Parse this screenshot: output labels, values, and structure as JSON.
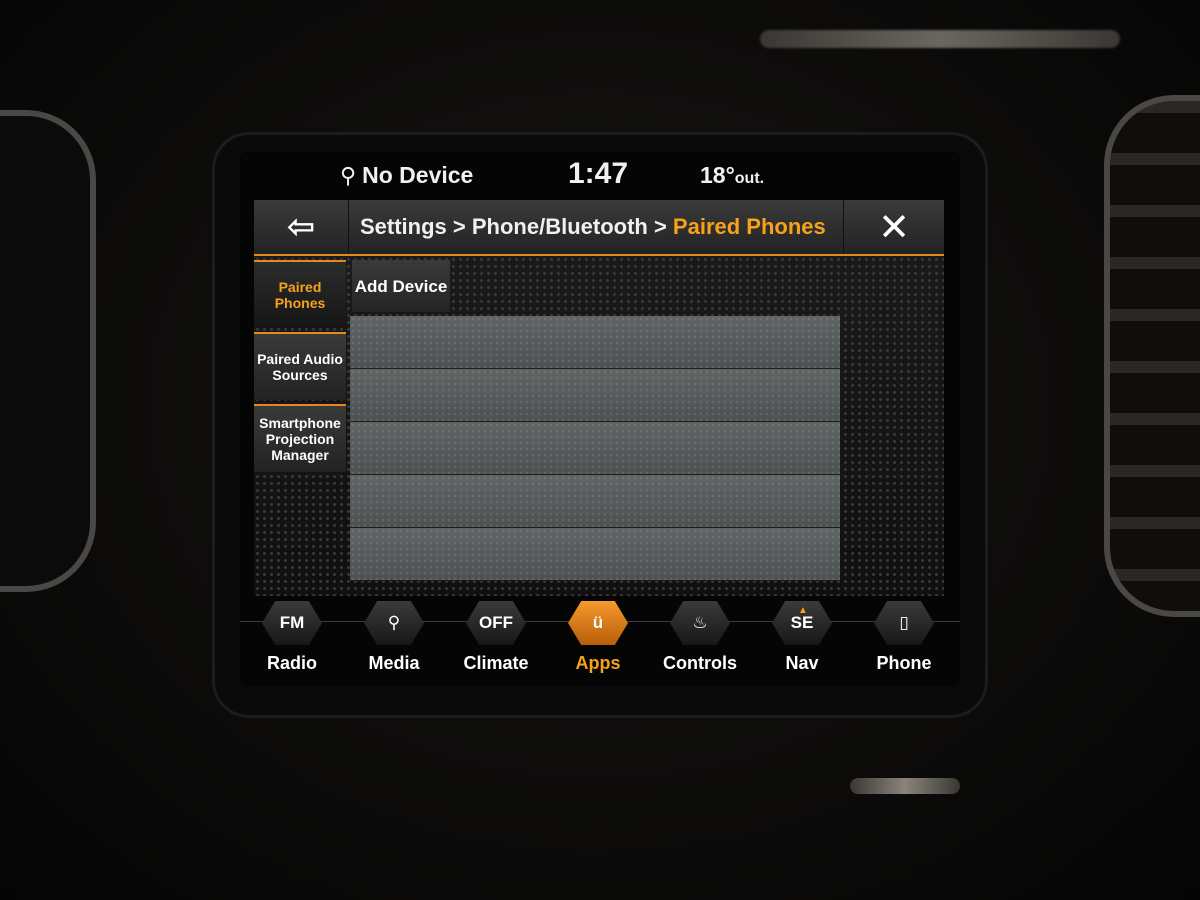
{
  "status": {
    "device_text": "No Device",
    "time": "1:47",
    "temp_value": "18°",
    "temp_suffix": "out."
  },
  "header": {
    "breadcrumb_path": "Settings > Phone/Bluetooth > ",
    "breadcrumb_current": "Paired Phones"
  },
  "sidebar": {
    "items": [
      {
        "label": "Paired Phones",
        "active": true
      },
      {
        "label": "Paired Audio Sources",
        "active": false
      },
      {
        "label": "Smartphone Projection Manager",
        "active": false
      }
    ]
  },
  "main": {
    "add_device_label": "Add Device",
    "device_list": [
      "",
      "",
      "",
      "",
      ""
    ]
  },
  "bottom_nav": {
    "items": [
      {
        "icon_text": "FM",
        "label": "Radio",
        "icon": "fm-icon"
      },
      {
        "icon_text": "",
        "label": "Media",
        "icon": "usb-icon"
      },
      {
        "icon_text": "OFF",
        "label": "Climate",
        "icon": "climate-icon"
      },
      {
        "icon_text": "",
        "label": "Apps",
        "icon": "uconnect-icon"
      },
      {
        "icon_text": "",
        "label": "Controls",
        "icon": "seat-icon"
      },
      {
        "icon_text": "SE",
        "label": "Nav",
        "icon": "compass-icon"
      },
      {
        "icon_text": "",
        "label": "Phone",
        "icon": "phone-icon"
      }
    ]
  },
  "colors": {
    "accent": "#f7a21b",
    "text": "#ffffff",
    "bar": "#2a2a2a",
    "list_row": "#565b5b"
  }
}
